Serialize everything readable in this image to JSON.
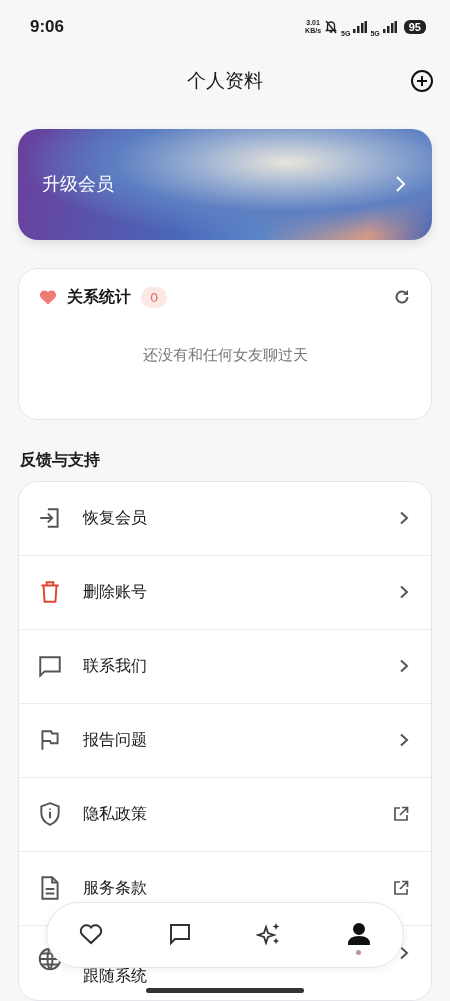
{
  "status_bar": {
    "time": "9:06",
    "net_speed": "3.01",
    "net_unit": "KB/s",
    "sim1": "5G",
    "sim2": "5G",
    "battery": "95"
  },
  "header": {
    "title": "个人资料"
  },
  "banner": {
    "label": "升级会员"
  },
  "stats": {
    "title": "关系统计",
    "count": "0",
    "empty_text": "还没有和任何女友聊过天"
  },
  "section_title": "反馈与支持",
  "menu": [
    {
      "label": "恢复会员",
      "kind": "chevron",
      "danger": false
    },
    {
      "label": "删除账号",
      "kind": "chevron",
      "danger": true
    },
    {
      "label": "联系我们",
      "kind": "chevron",
      "danger": false
    },
    {
      "label": "报告问题",
      "kind": "chevron",
      "danger": false
    },
    {
      "label": "隐私政策",
      "kind": "external",
      "danger": false
    },
    {
      "label": "服务条款",
      "kind": "external",
      "danger": false
    },
    {
      "label": "跟随系统",
      "kind": "chevron",
      "danger": false
    }
  ],
  "tabs": [
    {
      "selected": false
    },
    {
      "selected": false
    },
    {
      "selected": false
    },
    {
      "selected": true
    }
  ]
}
